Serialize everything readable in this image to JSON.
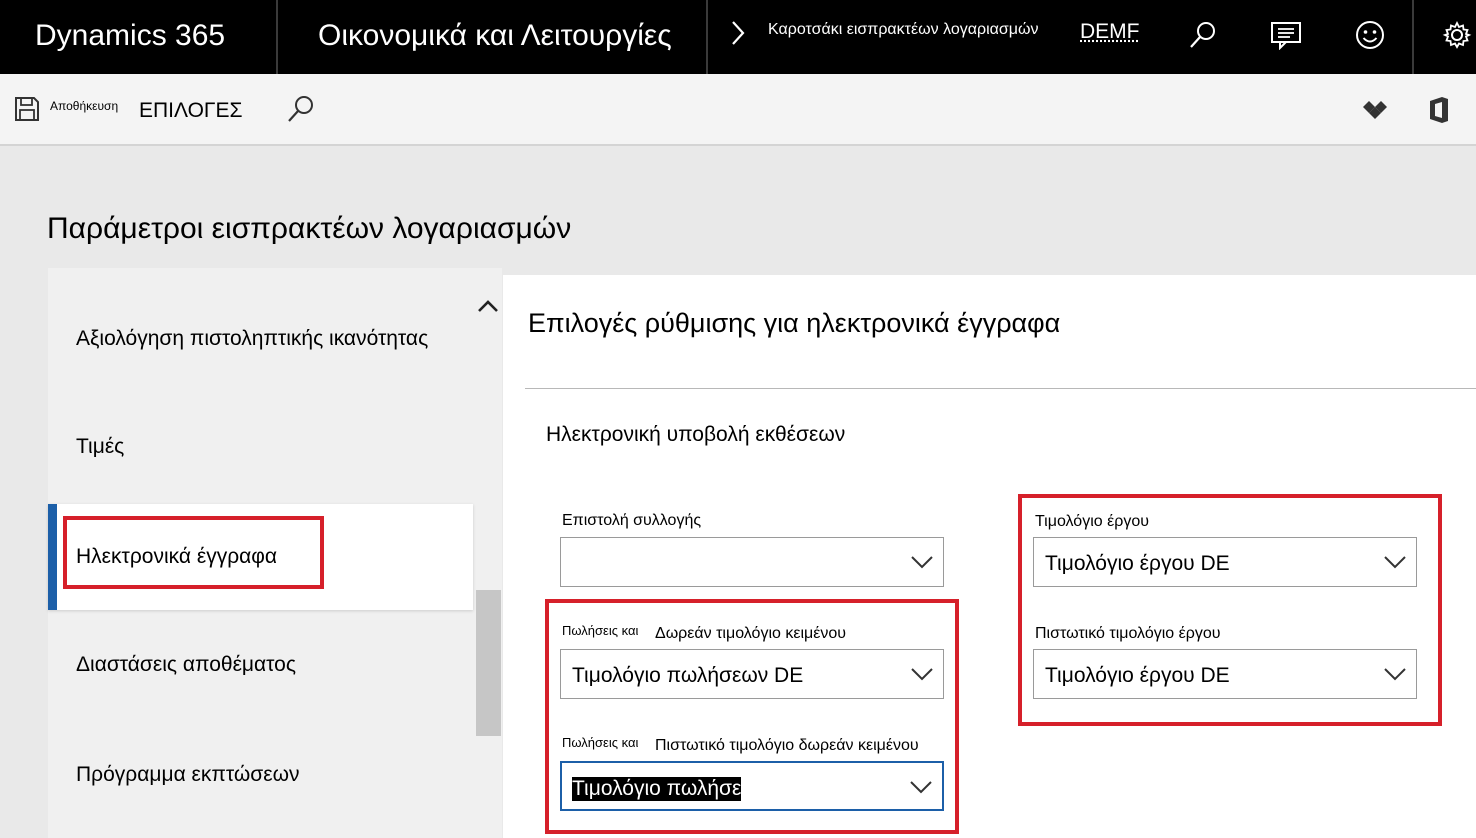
{
  "app": {
    "brand": "Dynamics 365",
    "module": "Οικονομικά και Λειτουργίες",
    "breadcrumb": "Καροτσάκι εισπρακτέων λογαριασμών",
    "company": "DEMF"
  },
  "top_icons": [
    "search-icon",
    "message-icon",
    "smiley-icon",
    "gear-icon"
  ],
  "actionbar": {
    "save_label": "Αποθήκευση",
    "options_label": "ΕΠΙΛΟΓΕΣ"
  },
  "page": {
    "title": "Παράμετροι εισπρακτέων λογαριασμών"
  },
  "nav": {
    "items": [
      {
        "label": "Αξιολόγηση πιστοληπτικής ικανότητας"
      },
      {
        "label": "Τιμές"
      },
      {
        "label": "Ηλεκτρονικά έγγραφα",
        "selected": true
      },
      {
        "label": "Διαστάσεις αποθέματος"
      },
      {
        "label": "Πρόγραμμα εκπτώσεων"
      }
    ]
  },
  "section": {
    "title": "Επιλογές ρύθμισης για ηλεκτρονικά έγγραφα",
    "group_title": "Ηλεκτρονική υποβολή εκθέσεων"
  },
  "fields": {
    "collection_letter": {
      "label": "Επιστολή συλλογής",
      "value": ""
    },
    "free_text_invoice": {
      "prefix": "Πωλήσεις και",
      "label": "Δωρεάν τιμολόγιο κειμένου",
      "value": "Τιμολόγιο πωλήσεων DE"
    },
    "free_text_credit": {
      "prefix": "Πωλήσεις και",
      "label": "Πιστωτικό τιμολόγιο δωρεάν κειμένου",
      "value": "Τιμολόγιο πωλήσε"
    },
    "project_invoice": {
      "label": "Τιμολόγιο έργου",
      "value": "Τιμολόγιο έργου DE"
    },
    "project_credit": {
      "label": "Πιστωτικό τιμολόγιο έργου",
      "value": "Τιμολόγιο έργου DE"
    }
  },
  "colors": {
    "topbar": "#000000",
    "accent": "#1c5fa8",
    "highlight": "#d6202a"
  }
}
